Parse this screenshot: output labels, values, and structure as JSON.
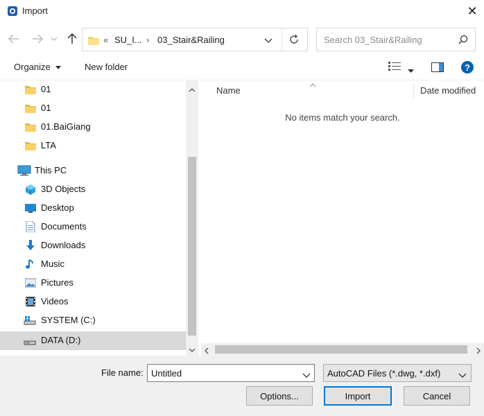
{
  "window": {
    "title": "Import",
    "icon": "app-icon",
    "close": "✕"
  },
  "nav": {
    "back_icon": "back-arrow-icon",
    "forward_icon": "forward-arrow-icon",
    "up_icon": "up-arrow-icon",
    "breadcrumb": {
      "overflow": "«",
      "item1": "SU_I...",
      "separator": "›",
      "item2": "03_Stair&Railing"
    },
    "search_placeholder": "Search 03_Stair&Railing"
  },
  "toolbar": {
    "organize": "Organize",
    "new_folder": "New folder"
  },
  "sidebar": {
    "items": [
      {
        "label": "01",
        "icon": "folder-icon"
      },
      {
        "label": "01",
        "icon": "folder-icon"
      },
      {
        "label": "01.BaiGiang",
        "icon": "folder-icon"
      },
      {
        "label": "LTA",
        "icon": "folder-icon"
      },
      {
        "label": "This PC",
        "icon": "computer-icon"
      },
      {
        "label": "3D Objects",
        "icon": "3d-objects-icon"
      },
      {
        "label": "Desktop",
        "icon": "desktop-icon"
      },
      {
        "label": "Documents",
        "icon": "documents-icon"
      },
      {
        "label": "Downloads",
        "icon": "downloads-icon"
      },
      {
        "label": "Music",
        "icon": "music-icon"
      },
      {
        "label": "Pictures",
        "icon": "pictures-icon"
      },
      {
        "label": "Videos",
        "icon": "videos-icon"
      },
      {
        "label": "SYSTEM (C:)",
        "icon": "system-drive-icon"
      },
      {
        "label": "DATA (D:)",
        "icon": "drive-icon"
      }
    ],
    "selected": "DATA (D:)"
  },
  "filelist": {
    "columns": [
      "Name",
      "Date modified"
    ],
    "empty_message": "No items match your search."
  },
  "bottom": {
    "filename_label": "File name:",
    "filename_value": "Untitled",
    "filetype_value": "AutoCAD Files (*.dwg, *.dxf)",
    "buttons": {
      "options": "Options...",
      "import": "Import",
      "cancel": "Cancel"
    }
  },
  "colors": {
    "accent": "#0078d7",
    "folder": "#f7d26a",
    "help": "#0063b1",
    "selected_bg": "#d9d9d9"
  }
}
